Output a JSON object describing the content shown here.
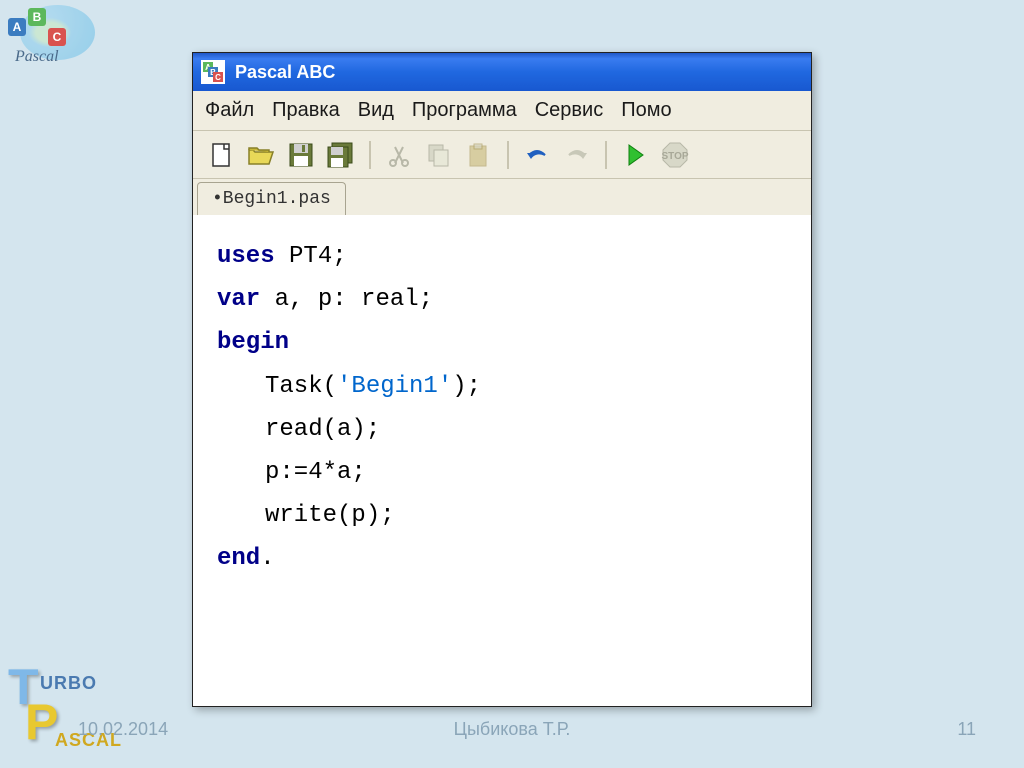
{
  "top_logo": {
    "text": "Pascal",
    "a": "A",
    "b": "B",
    "c": "C"
  },
  "window": {
    "title": "Pascal ABC",
    "icon": {
      "a": "A",
      "b": "B",
      "c": "C"
    }
  },
  "menu": {
    "file": "Файл",
    "edit": "Правка",
    "view": "Вид",
    "program": "Программа",
    "service": "Сервис",
    "help": "Помо"
  },
  "toolbar": {
    "new": "new",
    "open": "open",
    "save": "save",
    "saveall": "saveall",
    "cut": "cut",
    "copy": "copy",
    "paste": "paste",
    "undo": "undo",
    "redo": "redo",
    "run": "run",
    "stop": "stop"
  },
  "tab": {
    "label": "•Begin1.pas"
  },
  "code": {
    "l1_kw": "uses",
    "l1_rest": " PT4;",
    "l2_kw": "var",
    "l2_rest": " a, p: real;",
    "l3_kw": "begin",
    "l4_a": "Task(",
    "l4_str": "'Begin1'",
    "l4_b": ");",
    "l5": "read(a);",
    "l6": "p:=4*a;",
    "l7": "write(p);",
    "l8_kw": "end",
    "l8_rest": "."
  },
  "turbo": {
    "t": "T",
    "urbo": "URBO",
    "p": "P",
    "ascal": "ASCAL"
  },
  "footer": {
    "date": "10.02.2014",
    "author": "Цыбикова Т.Р.",
    "page": "11"
  }
}
